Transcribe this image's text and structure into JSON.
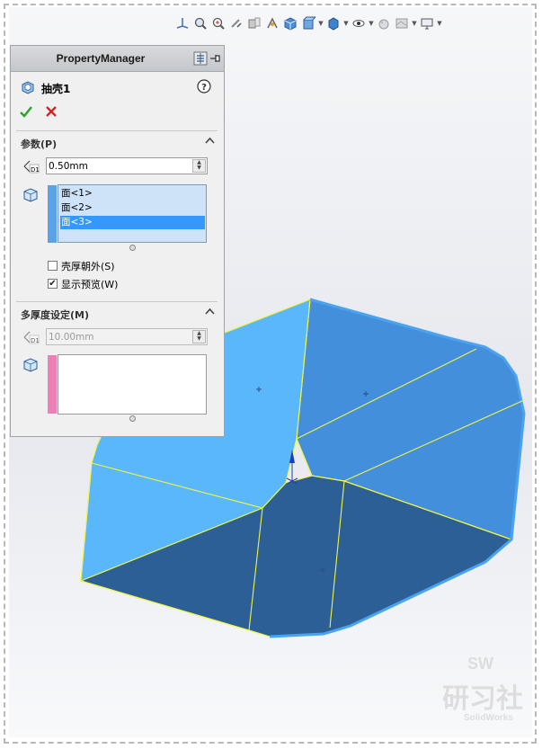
{
  "property_manager": {
    "header_title": "PropertyManager",
    "feature_name": "抽壳1",
    "help_icon": "help-circle-icon",
    "ok_icon": "green-check-icon",
    "cancel_icon": "red-x-icon",
    "params_section": {
      "title": "参数(P)",
      "thickness_value": "0.50mm",
      "faces": [
        "面<1>",
        "面<2>",
        "面<3>"
      ],
      "selected_face_index": 2,
      "shell_outward_label": "壳厚朝外(S)",
      "shell_outward_checked": false,
      "show_preview_label": "显示预览(W)",
      "show_preview_checked": true
    },
    "multi_thickness_section": {
      "title": "多厚度设定(M)",
      "thickness_value": "10.00mm",
      "faces": []
    }
  },
  "watermark": {
    "line1": "SW",
    "line2": "研习社",
    "line3": "SolidWorks"
  },
  "colors": {
    "face_light": "#5ab8fa",
    "face_mid": "#438fdc",
    "face_dark": "#2c5f96",
    "edge_yellow": "#f2f542",
    "selection_bar": "#5aa2e6",
    "multi_bar": "#ee7fb7"
  }
}
